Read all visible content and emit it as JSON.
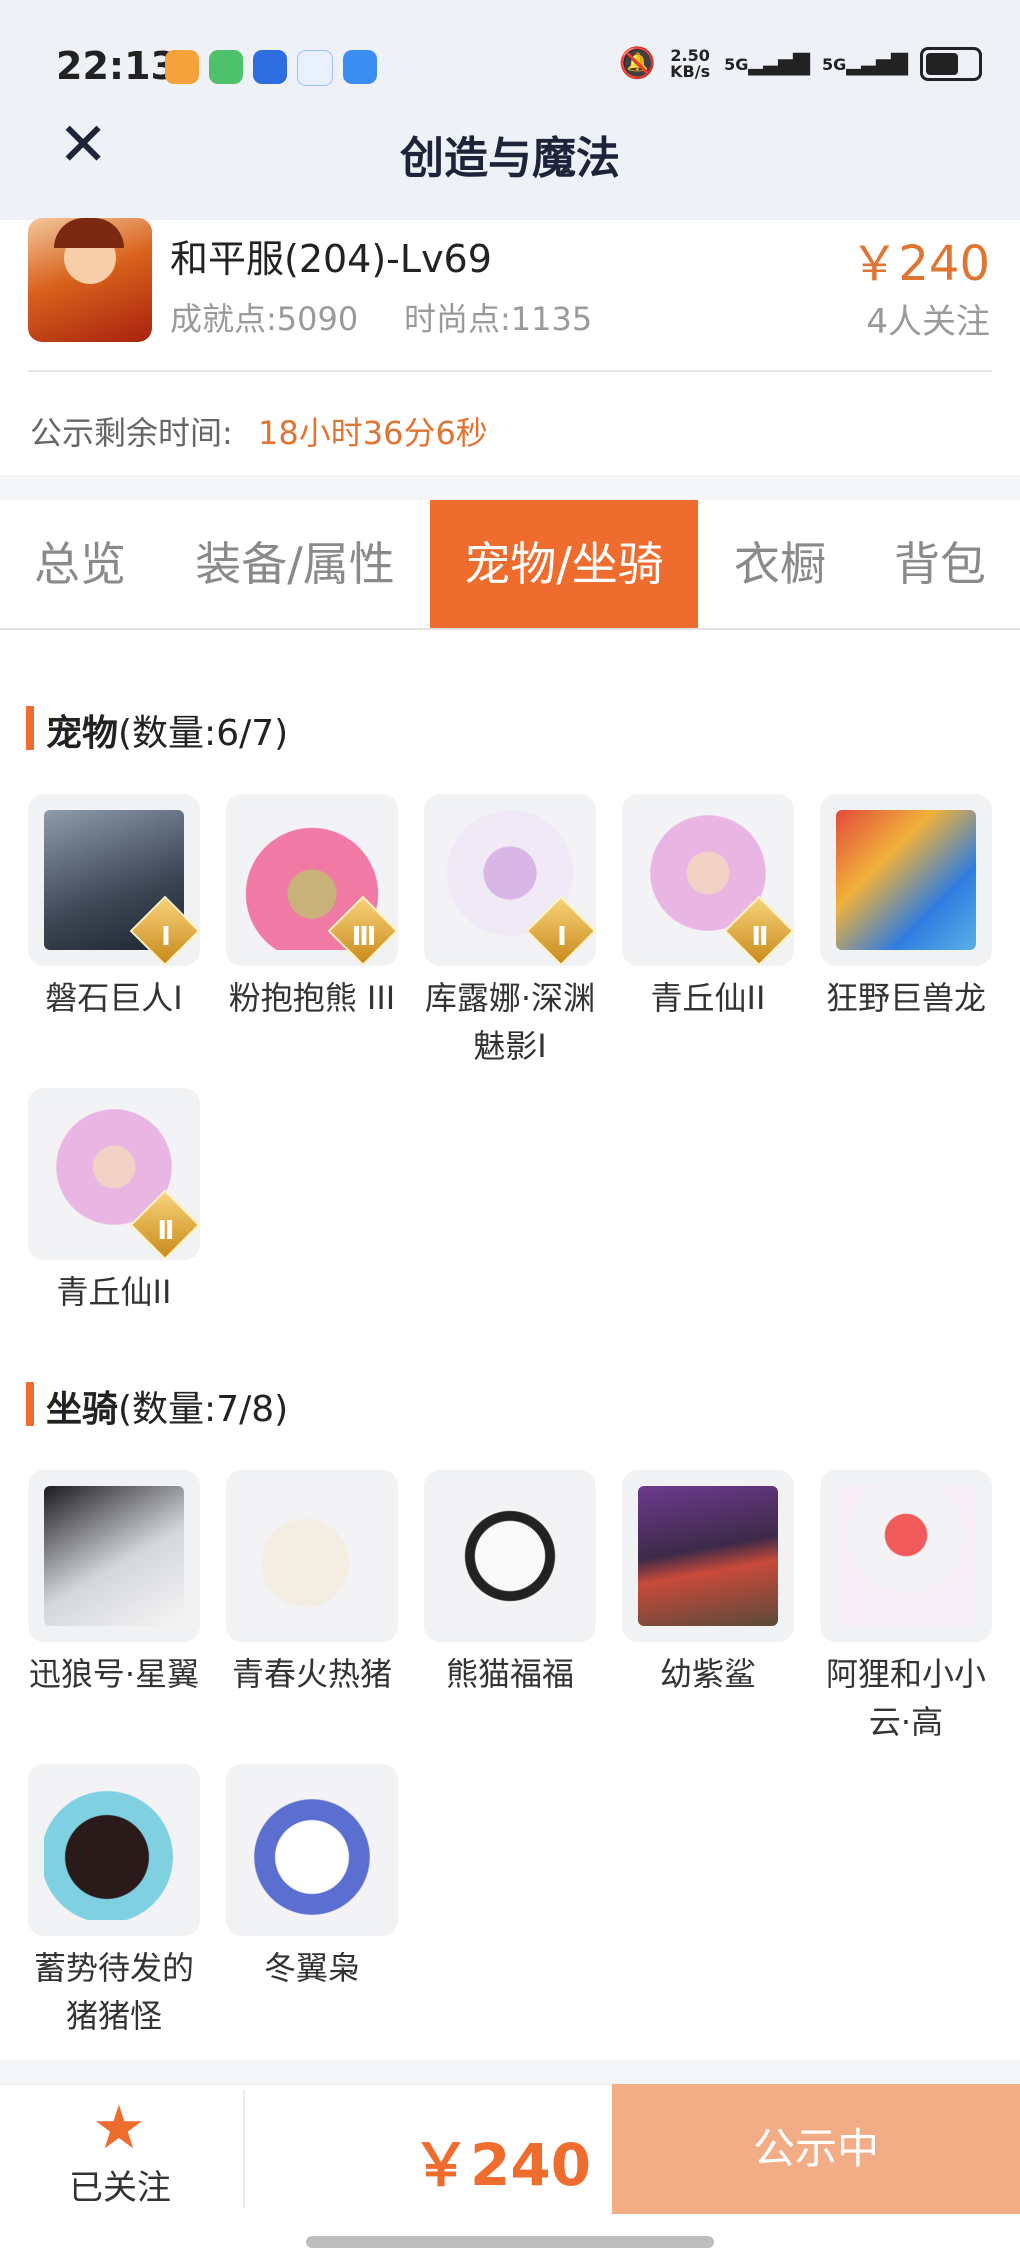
{
  "status_bar": {
    "time": "22:13",
    "net_speed": "2.50\nKB/s",
    "net_speed_value": "2.50",
    "net_speed_unit": "KB/s",
    "signal1": "5G",
    "signal2": "5G"
  },
  "header": {
    "title": "创造与魔法",
    "close_icon": "close-icon"
  },
  "listing": {
    "name": "和平服(204)-Lv69",
    "achievement": "成就点:5090",
    "fashion": "时尚点:1135",
    "price": "￥240",
    "watchers": "4人关注",
    "countdown_label": "公示剩余时间:",
    "countdown_value": "18小时36分6秒"
  },
  "tabs": [
    "总览",
    "装备/属性",
    "宠物/坐骑",
    "衣橱",
    "背包"
  ],
  "active_tab": 2,
  "pets": {
    "title": "宠物",
    "count": "(数量:6/7)",
    "items": [
      {
        "name": "磐石巨人Ⅰ",
        "badge": "Ⅰ"
      },
      {
        "name": "粉抱抱熊 III",
        "badge": "Ⅲ"
      },
      {
        "name": "库露娜·深渊魅影I",
        "badge": "Ⅰ"
      },
      {
        "name": "青丘仙II",
        "badge": "Ⅱ"
      },
      {
        "name": "狂野巨兽龙",
        "badge": ""
      },
      {
        "name": "青丘仙II",
        "badge": "Ⅱ"
      }
    ]
  },
  "mounts": {
    "title": "坐骑",
    "count": "(数量:7/8)",
    "items": [
      {
        "name": "迅狼号·星翼"
      },
      {
        "name": "青春火热猪"
      },
      {
        "name": "熊猫福福"
      },
      {
        "name": "幼紫鲨"
      },
      {
        "name": "阿狸和小小云·高"
      },
      {
        "name": "蓄势待发的猪猪怪"
      },
      {
        "name": "冬翼枭"
      }
    ]
  },
  "bottom": {
    "follow_label": "已关注",
    "price": "￥240",
    "status_button": "公示中"
  },
  "colors": {
    "accent": "#ef6c2f",
    "button_disabled": "#f3ad86"
  }
}
